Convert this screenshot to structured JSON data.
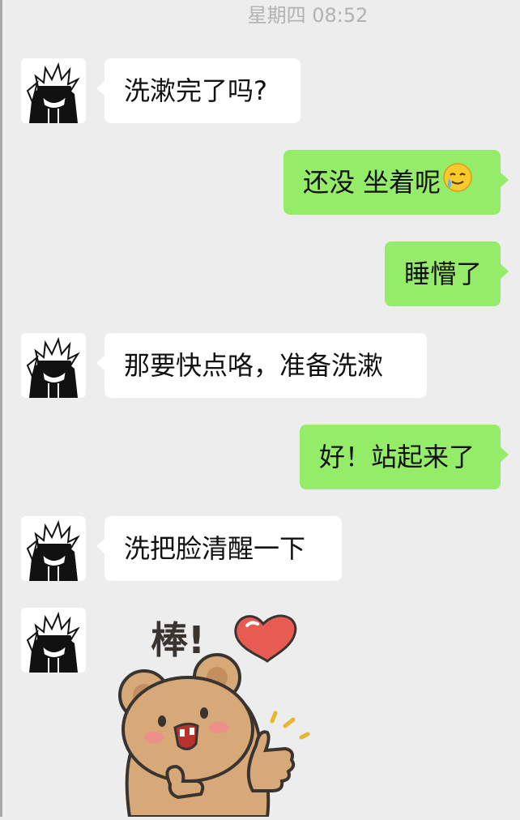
{
  "header": {
    "timestamp": "星期四 08:52"
  },
  "messages": [
    {
      "side": "in",
      "text": "洗漱完了吗?"
    },
    {
      "side": "out",
      "text": "还没 坐着呢",
      "emoji": "tears-of-joy-emoji"
    },
    {
      "side": "out",
      "text": "睡懵了"
    },
    {
      "side": "in",
      "text": "那要快点咯，准备洗漱"
    },
    {
      "side": "out",
      "text": "好！站起来了"
    },
    {
      "side": "in",
      "text": "洗把脸清醒一下"
    },
    {
      "side": "in",
      "sticker": {
        "icon": "thumbs-up-bear-sticker",
        "caption": "棒!"
      }
    }
  ],
  "colors": {
    "background": "#ededed",
    "incoming_bubble": "#ffffff",
    "outgoing_bubble": "#95ec69"
  }
}
